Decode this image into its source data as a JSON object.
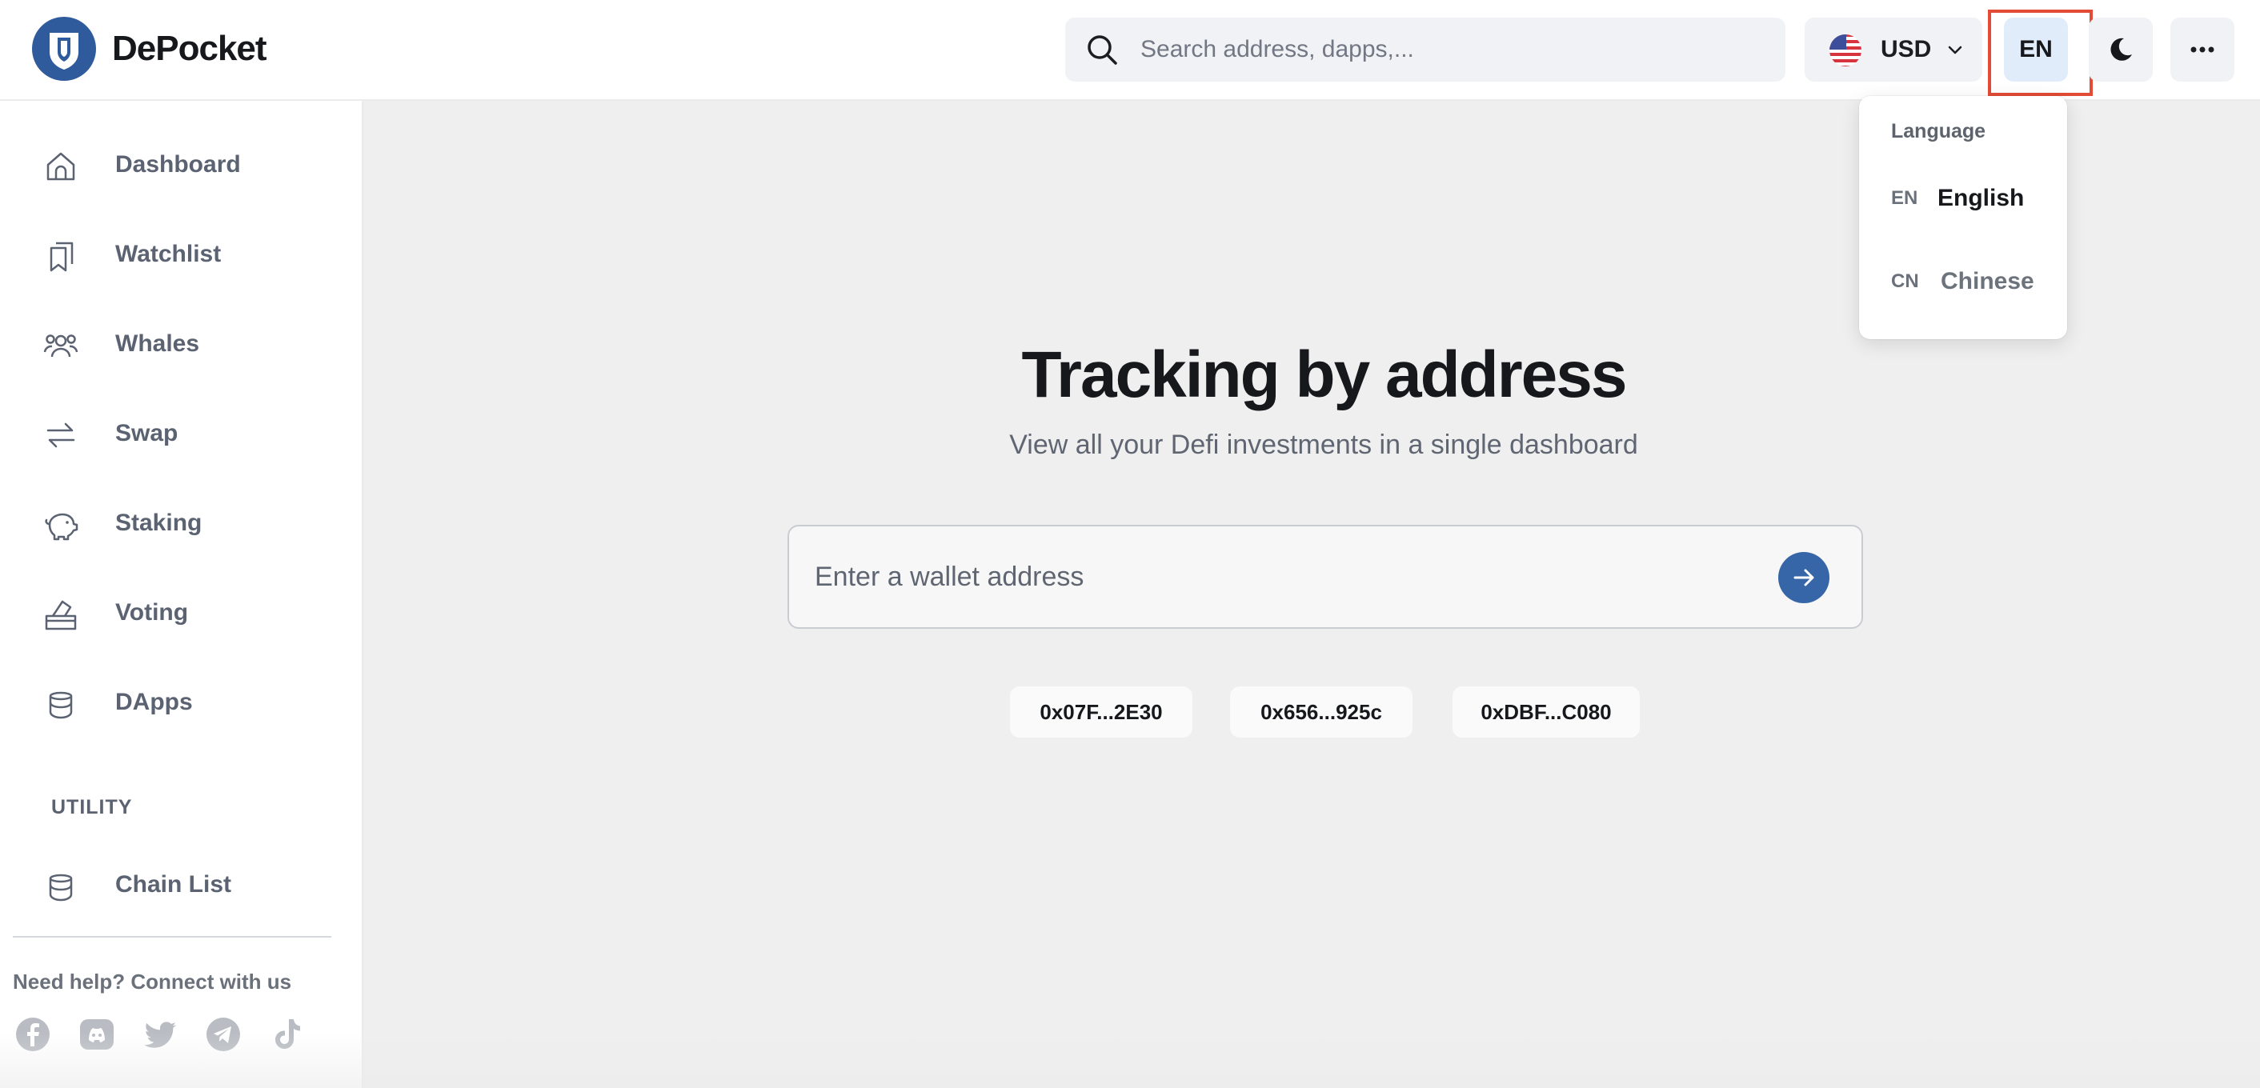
{
  "app": {
    "brand": "DePocket"
  },
  "header": {
    "search_placeholder": "Search address, dapps,...",
    "currency": {
      "code": "USD",
      "flag_icon": "us-flag-icon"
    },
    "language_button": "EN",
    "theme_icon": "moon-icon",
    "more_icon": "more-dots-icon",
    "highlight_color": "#e24b35"
  },
  "language_menu": {
    "title": "Language",
    "options": [
      {
        "abbr": "EN",
        "name": "English",
        "active": true
      },
      {
        "abbr": "CN",
        "name": "Chinese",
        "active": false
      }
    ]
  },
  "sidebar": {
    "items": [
      {
        "label": "Dashboard",
        "icon": "home-icon"
      },
      {
        "label": "Watchlist",
        "icon": "bookmark-icon"
      },
      {
        "label": "Whales",
        "icon": "users-icon"
      },
      {
        "label": "Swap",
        "icon": "swap-icon"
      },
      {
        "label": "Staking",
        "icon": "piggy-bank-icon"
      },
      {
        "label": "Voting",
        "icon": "ballot-box-icon"
      },
      {
        "label": "DApps",
        "icon": "stack-icon"
      }
    ],
    "utility_label": "UTILITY",
    "utility_items": [
      {
        "label": "Chain List",
        "icon": "stack-icon"
      }
    ],
    "help_text": "Need help? Connect with us",
    "socials": [
      "facebook-icon",
      "discord-icon",
      "twitter-icon",
      "telegram-icon",
      "tiktok-icon"
    ]
  },
  "main": {
    "title": "Tracking by address",
    "subtitle": "View all your Defi investments in a single dashboard",
    "wallet_placeholder": "Enter a wallet address",
    "accent_color": "#3766a8",
    "sample_addresses": [
      "0x07F...2E30",
      "0x656...925c",
      "0xDBF...C080"
    ]
  }
}
